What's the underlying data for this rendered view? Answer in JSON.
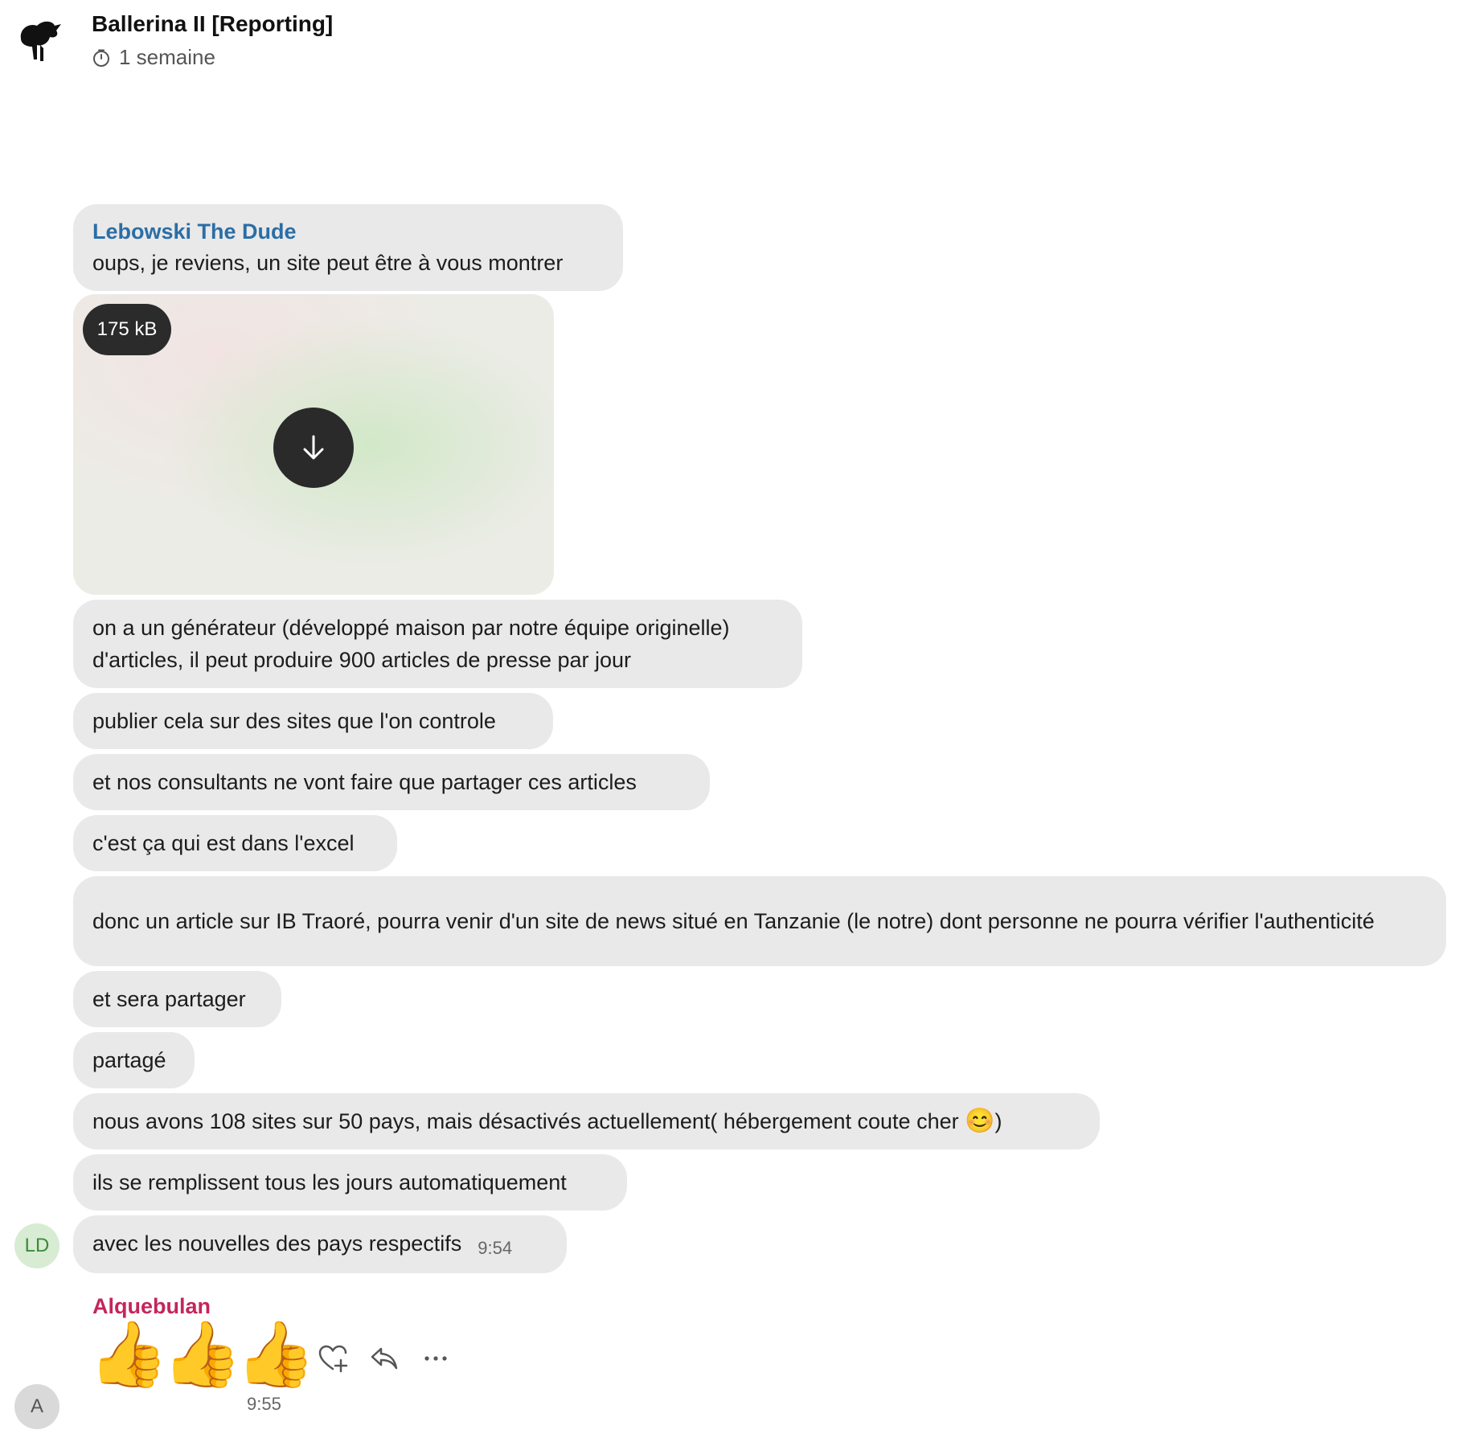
{
  "header": {
    "title": "Ballerina II [Reporting]",
    "subtitle": "1 semaine"
  },
  "messages": [
    {
      "sender": "Lebowski The Dude",
      "text": "oups, je reviens, un site peut être à vous montrer"
    },
    {
      "text": "on a un générateur (développé maison par notre équipe originelle) d'articles, il peut produire 900 articles de presse par jour"
    },
    {
      "text": "publier cela sur des sites que l'on controle"
    },
    {
      "text": "et nos consultants ne vont faire que partager ces articles"
    },
    {
      "text": "c'est ça qui est dans l'excel"
    },
    {
      "text": "donc un article sur IB Traoré, pourra venir d'un site de news situé en Tanzanie (le notre) dont personne ne pourra vérifier l'authenticité"
    },
    {
      "text": "et sera partager"
    },
    {
      "text": "partagé"
    },
    {
      "text_before": "nous avons 108 sites sur 50 pays, mais désactivés actuellement( hébergement coute cher ",
      "emoji": "😊",
      "text_after": ")"
    },
    {
      "text": "ils se remplissent tous les jours automatiquement"
    },
    {
      "text": "avec les nouvelles des pays respectifs",
      "time": "9:54"
    }
  ],
  "media": {
    "size": "175 kB"
  },
  "avatars": {
    "ld": "LD",
    "a": "A"
  },
  "reply": {
    "sender": "Alquebulan",
    "emoji": "👍👍👍",
    "time": "9:55"
  }
}
